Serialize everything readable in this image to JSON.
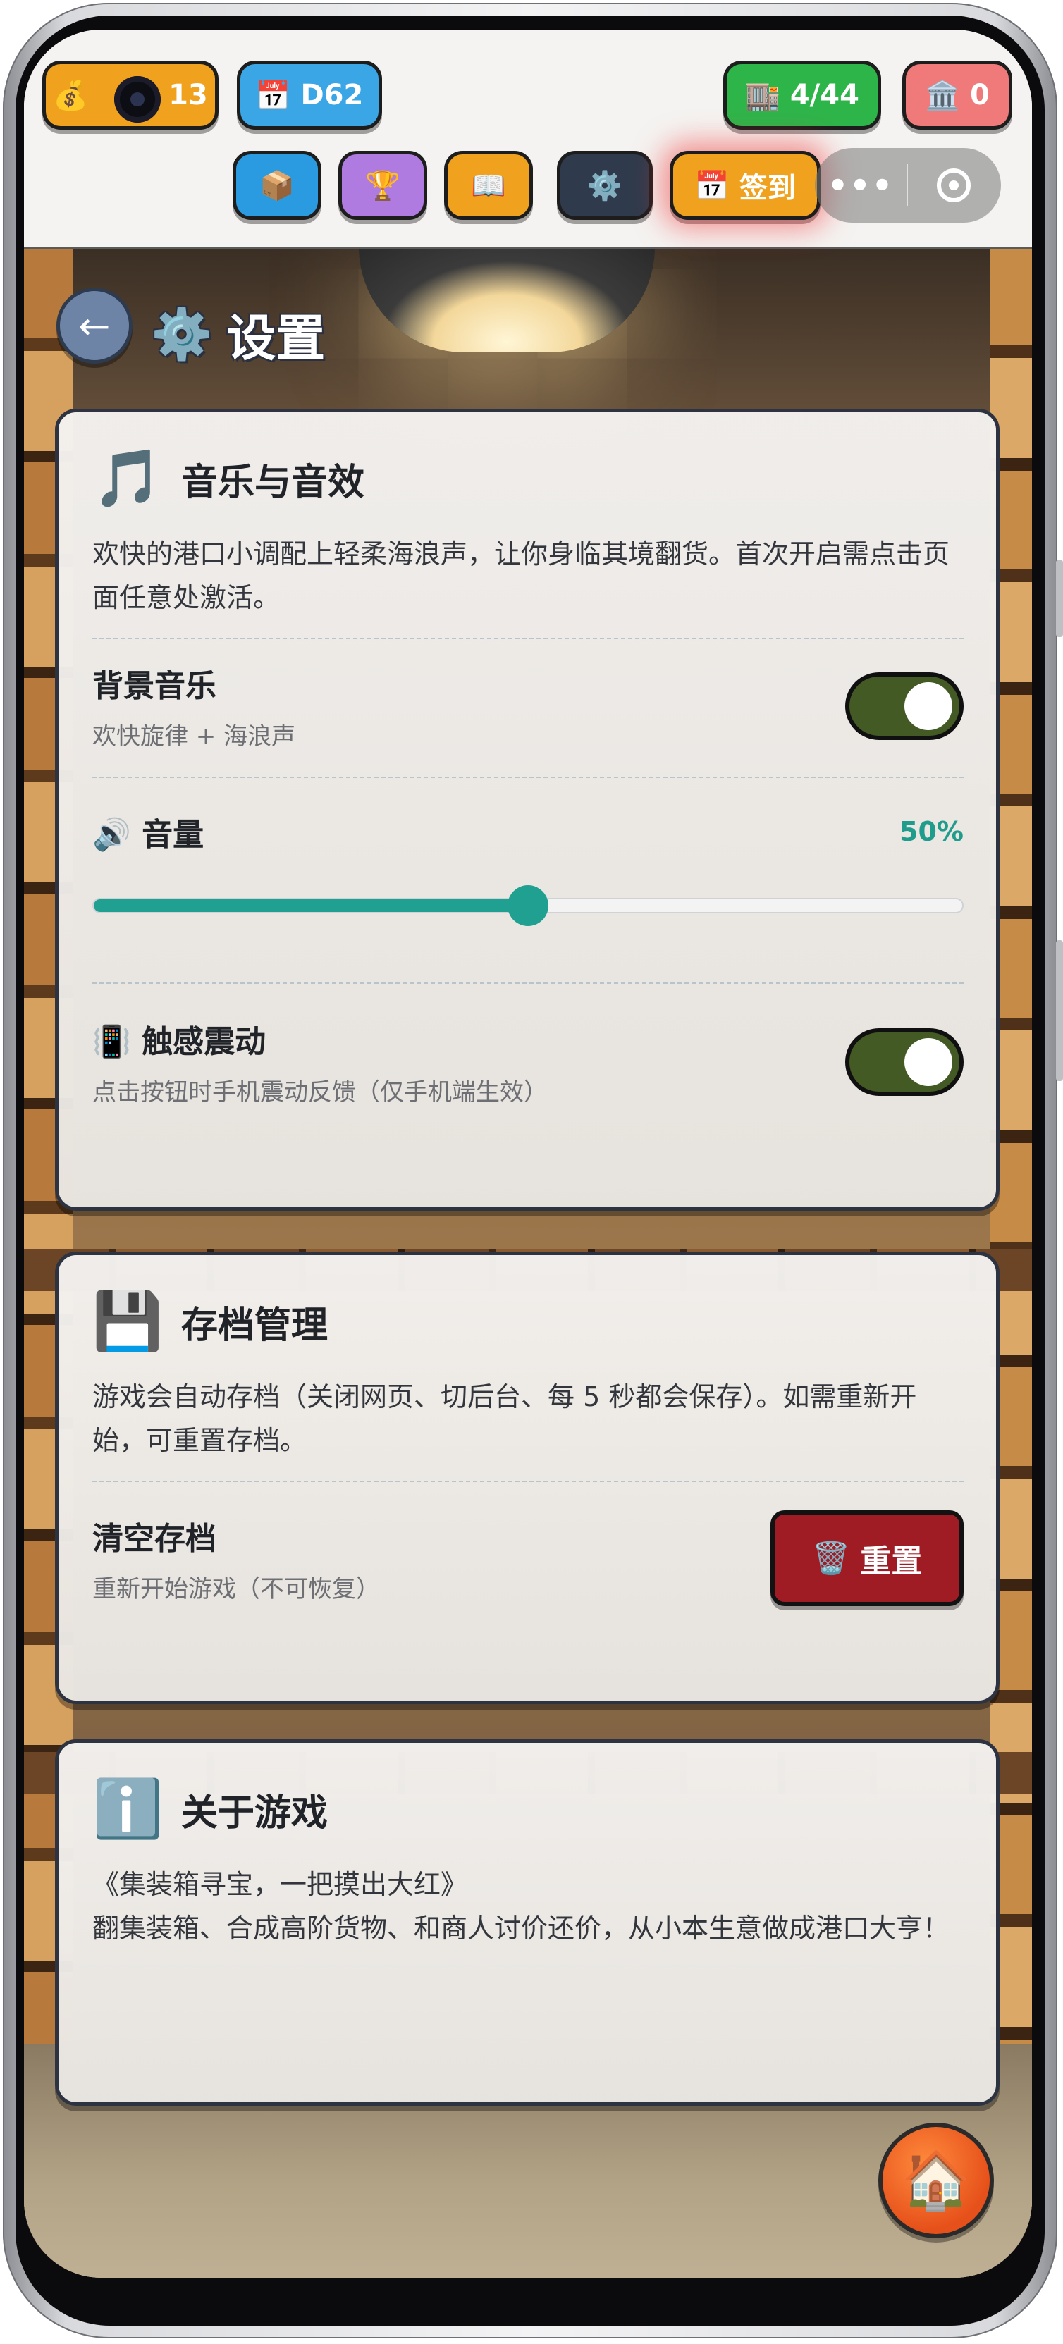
{
  "topbar": {
    "coins": {
      "icon": "money-bag-icon",
      "value": "13"
    },
    "day": {
      "icon": "calendar-icon",
      "value": "D62"
    },
    "warehouse": {
      "icon": "warehouse-icon",
      "value": "4/44"
    },
    "bank": {
      "icon": "bank-icon",
      "value": "0"
    },
    "toolbar": [
      {
        "icon": "package-icon"
      },
      {
        "icon": "trophy-icon"
      },
      {
        "icon": "book-icon"
      },
      {
        "icon": "gear-icon"
      }
    ],
    "signin_label": "签到",
    "more_label": "•••"
  },
  "header": {
    "title": "设置"
  },
  "audio": {
    "title": "音乐与音效",
    "desc": "欢快的港口小调配上轻柔海浪声，让你身临其境翻货。首次开启需点击页面任意处激活。",
    "bgm_label": "背景音乐",
    "bgm_sub": "欢快旋律 + 海浪声",
    "bgm_on": true,
    "volume_label": "音量",
    "volume_value": "50%",
    "volume_level": 0.5,
    "haptic_label": "触感震动",
    "haptic_sub": "点击按钮时手机震动反馈（仅手机端生效）",
    "haptic_on": true
  },
  "save": {
    "title": "存档管理",
    "desc": "游戏会自动存档（关闭网页、切后台、每 5 秒都会保存）。如需重新开始，可重置存档。",
    "clear_label": "清空存档",
    "clear_sub": "重新开始游戏（不可恢复）",
    "reset_button": "重置"
  },
  "about": {
    "title": "关于游戏",
    "line1": "《集装箱寻宝，一把摸出大红》",
    "line2": "翻集装箱、合成高阶货物、和商人讨价还价，从小本生意做成港口大亨！"
  },
  "colors": {
    "accent": "#20a091",
    "toggle_on": "#435a24",
    "danger": "#a01c24"
  }
}
